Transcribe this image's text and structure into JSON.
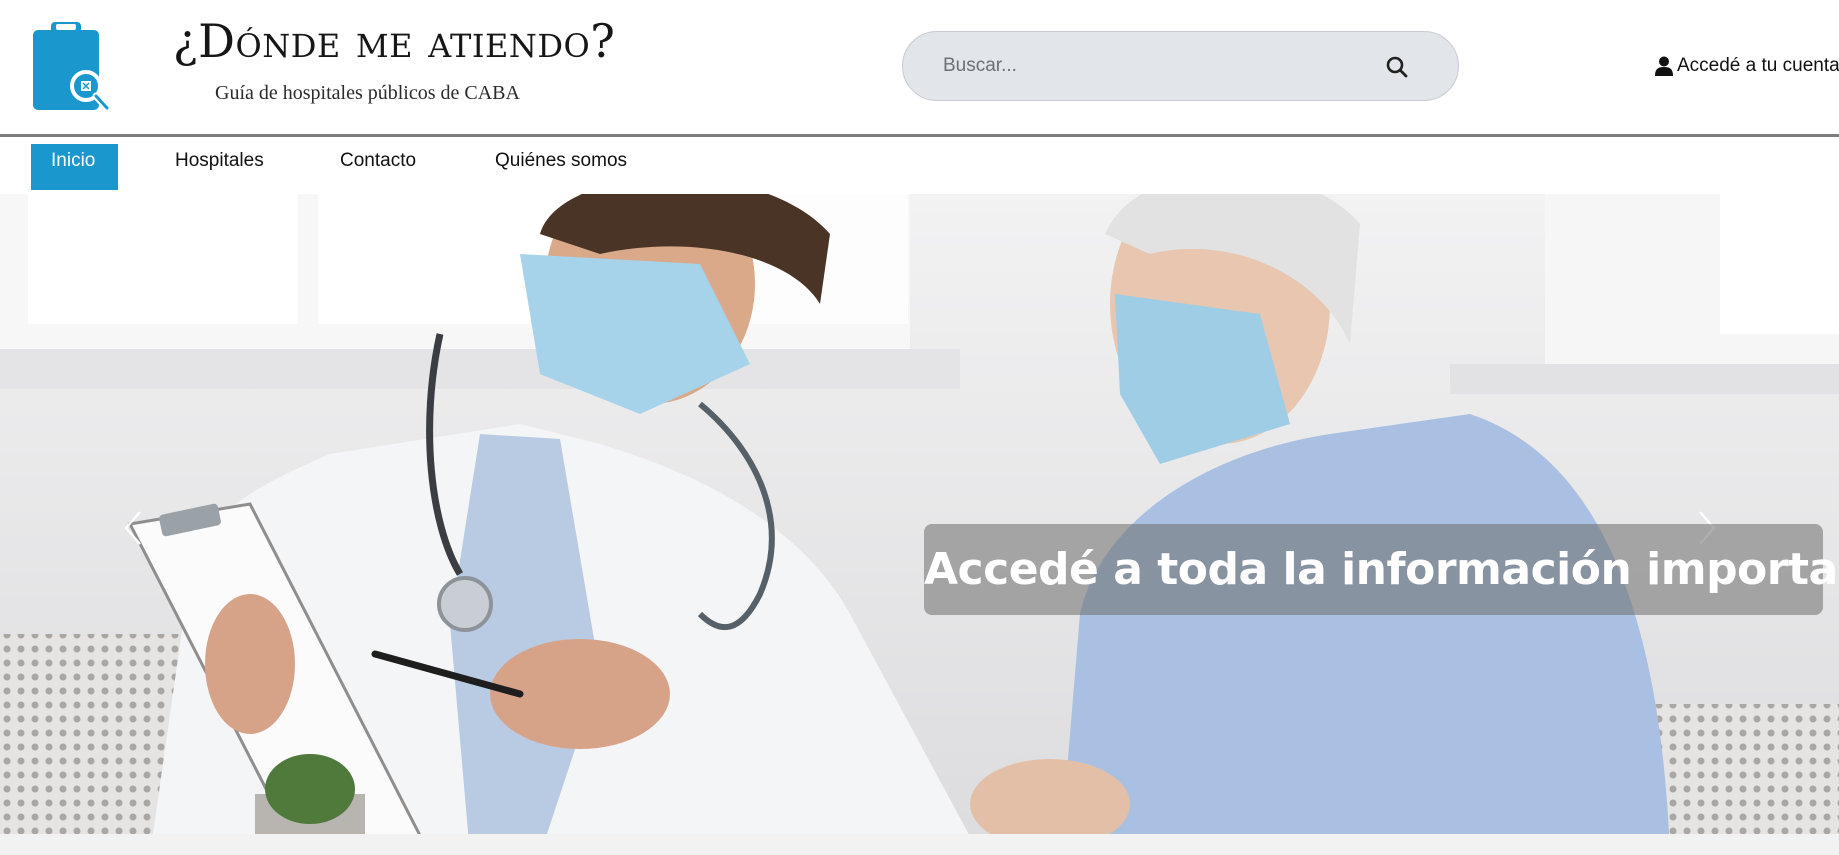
{
  "brand": {
    "title": "¿Dónde me atiendo?",
    "subtitle": "Guía de hospitales públicos de CABA",
    "logo_icon": "clipboard-search-icon",
    "accent_color": "#1a97cd"
  },
  "search": {
    "placeholder": "Buscar...",
    "value": "",
    "icon": "search-icon"
  },
  "account": {
    "label": "Accedé a tu cuenta",
    "icon": "user-icon"
  },
  "nav": {
    "items": [
      {
        "label": "Inicio",
        "active": true
      },
      {
        "label": "Hospitales",
        "active": false
      },
      {
        "label": "Contacto",
        "active": false
      },
      {
        "label": "Quiénes somos",
        "active": false
      }
    ]
  },
  "hero": {
    "caption": "Accedé a toda la información importante.",
    "prev_icon": "chevron-left-icon",
    "next_icon": "chevron-right-icon"
  }
}
